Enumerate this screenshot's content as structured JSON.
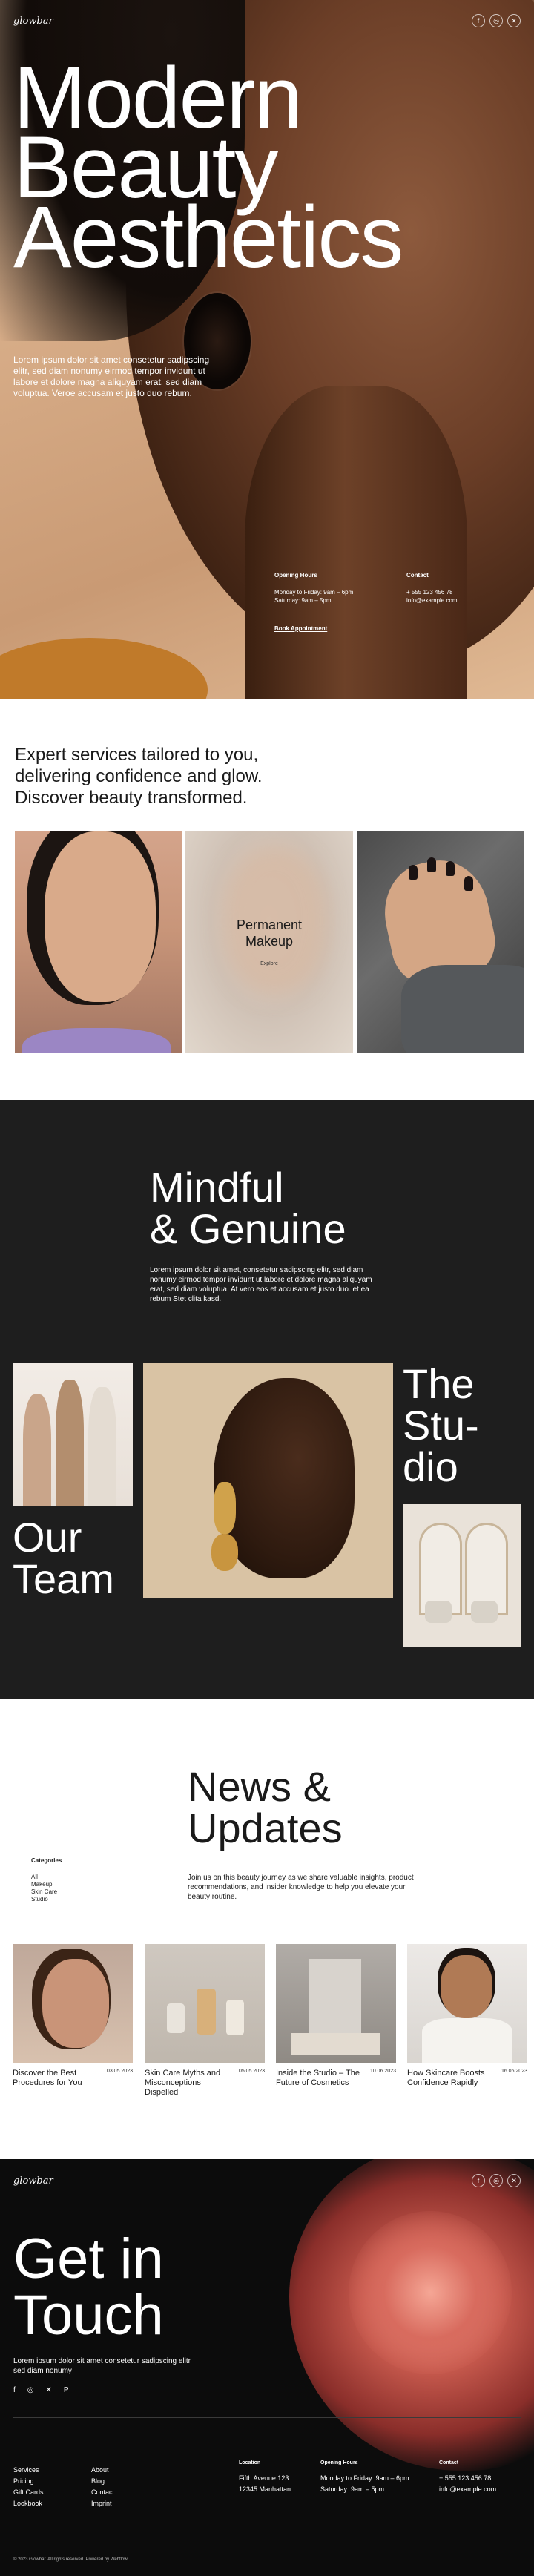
{
  "hero": {
    "logo": "glowbar",
    "social": [
      "f",
      "◎",
      "✕"
    ],
    "title_lines": [
      "Modern",
      "Beauty",
      "Aesthetics"
    ],
    "intro": "Lorem ipsum dolor sit amet consetetur sadipscing elitr, sed diam nonumy eirmod tempor invidunt ut labore et dolore magna aliquyam erat, sed diam voluptua. Veroe accusam et justo duo rebum.",
    "hours_heading": "Opening Hours",
    "hours": [
      "Monday to Friday: 9am – 6pm",
      "Saturday: 9am – 5pm"
    ],
    "contact_heading": "Contact",
    "contact": [
      "+ 555 123 456 78",
      "info@example.com"
    ],
    "book_label": "Book Appointment"
  },
  "services": {
    "heading": "Expert services tailored to you, delivering confidence and glow. Discover beauty transformed.",
    "card_title_lines": [
      "Permanent",
      "Makeup"
    ],
    "card_link": "Explore"
  },
  "mindful": {
    "heading_lines": [
      "Mindful",
      "& Genuine"
    ],
    "text": "Lorem ipsum dolor sit amet, consetetur sadipscing elitr, sed diam nonumy eirmod tempor invidunt ut labore et dolore magna aliquyam erat, sed diam voluptua. At vero eos et accusam et justo duo. et ea rebum Stet clita kasd.",
    "team_lines": [
      "Our",
      "Team"
    ],
    "studio_lines": [
      "The",
      "Stu-",
      "dio"
    ]
  },
  "news": {
    "heading_lines": [
      "News &",
      "Updates"
    ],
    "categories_heading": "Categories",
    "categories": [
      "All",
      "Makeup",
      "Skin Care",
      "Studio"
    ],
    "intro": "Join us on this beauty journey as we share valuable insights, product recommendations, and insider knowledge to help you elevate your beauty routine.",
    "posts": [
      {
        "title": "Discover the Best Procedures for You",
        "date": "03.05.2023"
      },
      {
        "title": "Skin Care Myths and Misconceptions Dispelled",
        "date": "05.05.2023"
      },
      {
        "title": "Inside the Studio – The Future of Cosmetics",
        "date": "10.06.2023"
      },
      {
        "title": "How Skincare Boosts Confidence Rapidly",
        "date": "16.06.2023"
      }
    ]
  },
  "contact_section": {
    "logo": "glowbar",
    "social": [
      "f",
      "◎",
      "✕"
    ],
    "heading_lines": [
      "Get in",
      "Touch"
    ],
    "sub": "Lorem ipsum dolor sit amet consetetur sadipscing elitr sed diam nonumy",
    "icons": [
      "f",
      "◎",
      "✕",
      "P"
    ],
    "nav_col1": [
      "Services",
      "Pricing",
      "Gift Cards",
      "Lookbook"
    ],
    "nav_col2": [
      "About",
      "Blog",
      "Contact",
      "Imprint"
    ],
    "location_heading": "Location",
    "location": [
      "Fifth Avenue 123",
      "12345 Manhattan"
    ],
    "hours_heading": "Opening Hours",
    "hours": [
      "Monday to Friday: 9am – 6pm",
      "Saturday: 9am – 5pm"
    ],
    "contact_heading": "Contact",
    "contact": [
      "+ 555 123 456 78",
      "info@example.com"
    ],
    "copyright": "© 2023 Glowbar. All rights reserved. Powered by Webflow."
  },
  "colors": {
    "dark": "#1e1e1e",
    "footer": "#0c0c0c",
    "accent": "#c5584c",
    "skin": "#d6ab86"
  }
}
